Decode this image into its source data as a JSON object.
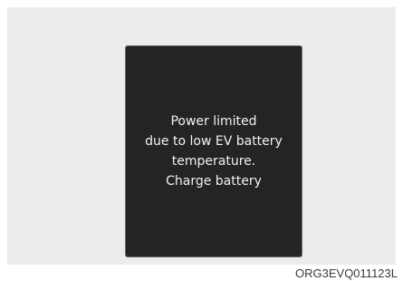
{
  "display": {
    "message_lines": [
      "Power limited",
      "due to low EV battery",
      "temperature.",
      "Charge battery"
    ]
  },
  "figure_code": "ORG3EVQ011123L",
  "colors": {
    "panel_background": "#ececec",
    "display_background": "#242424",
    "display_border": "#6e6e6e",
    "message_text": "#f2f2f2"
  }
}
